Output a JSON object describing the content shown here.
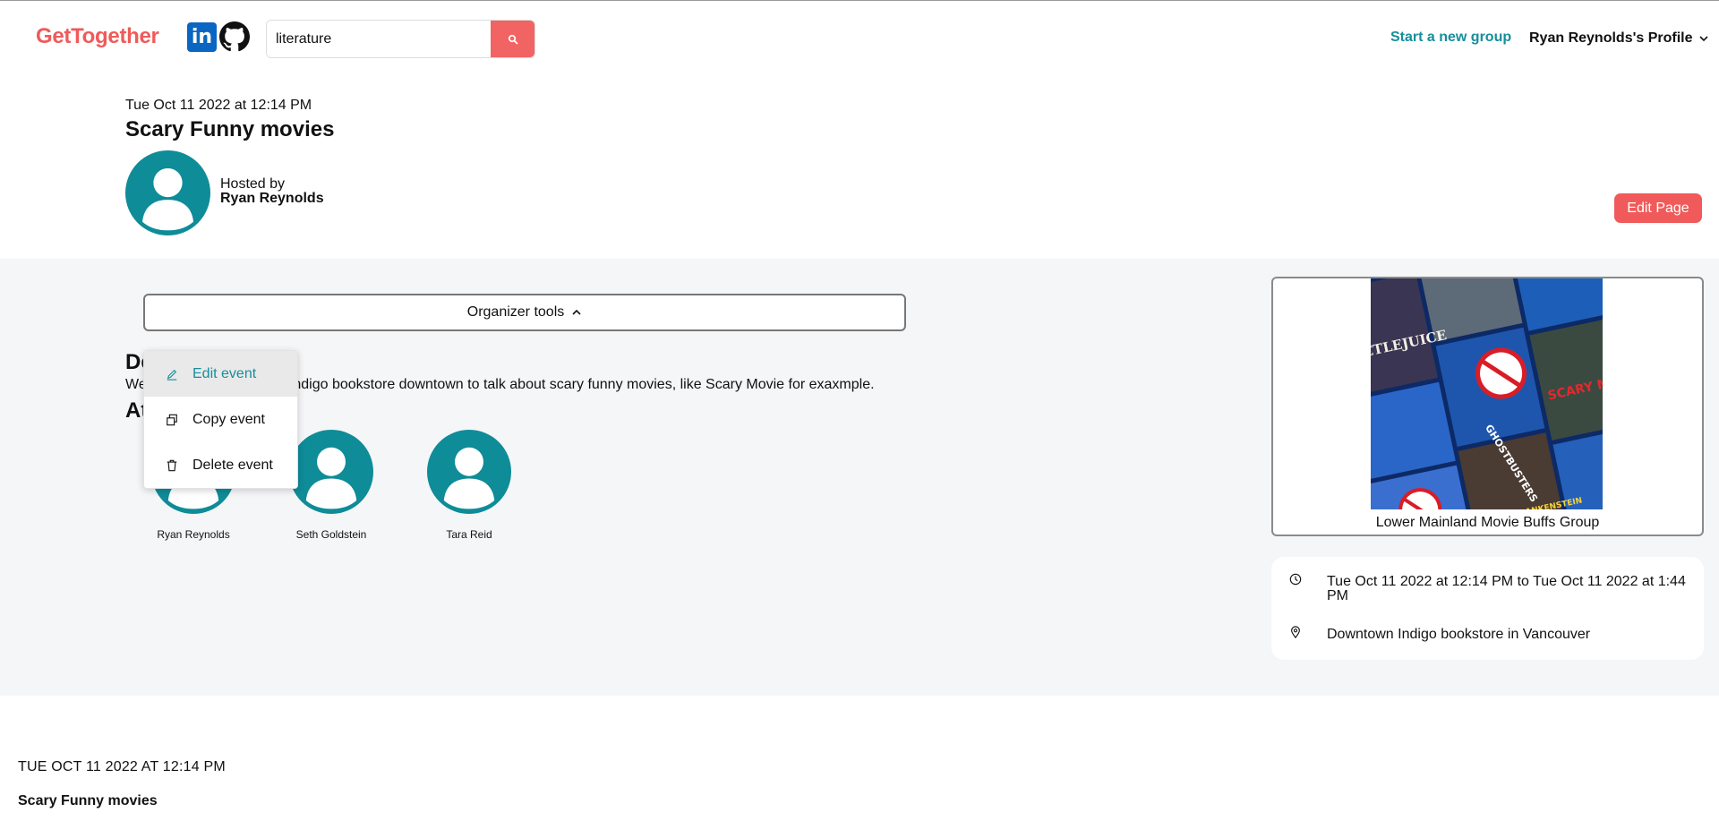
{
  "header": {
    "logo": "GetTogether",
    "linkedin_letters": "in",
    "search": {
      "value": "literature",
      "placeholder": ""
    },
    "start_group": "Start a new group",
    "profile": "Ryan Reynolds's Profile"
  },
  "event": {
    "date": "Tue Oct 11 2022 at 12:14 PM",
    "title": "Scary Funny movies",
    "hosted_by_label": "Hosted by",
    "host": "Ryan Reynolds",
    "edit_page": "Edit Page"
  },
  "body": {
    "organizer_tools": "Organizer tools",
    "details_heading": "Details",
    "details_text": "We will be meeting at the Indigo bookstore downtown to talk about scary funny movies, like Scary Movie for exaxmple.",
    "attendees_heading": "Attendees",
    "attendees": [
      "Ryan Reynolds",
      "Seth Goldstein",
      "Tara Reid"
    ]
  },
  "menu": {
    "items": [
      "Edit event",
      "Copy event",
      "Delete event"
    ]
  },
  "group": {
    "name": "Lower Mainland Movie Buffs Group",
    "poster_titles": [
      "BEETLEJUICE",
      "GHOSTBUSTERS",
      "SCARY MOVIE",
      "YOUNG FRANKENSTEIN"
    ]
  },
  "info": {
    "time": "Tue Oct 11 2022 at 12:14 PM to Tue Oct 11 2022 at 1:44 PM",
    "location": "Downtown Indigo bookstore in Vancouver"
  },
  "footer": {
    "date": "TUE OCT 11 2022 AT 12:14 PM",
    "title": "Scary Funny movies"
  },
  "colors": {
    "brand": "#f05a5a",
    "accent": "#168e9c",
    "avatar": "#0e8c98",
    "band": "#f5f6f7"
  }
}
